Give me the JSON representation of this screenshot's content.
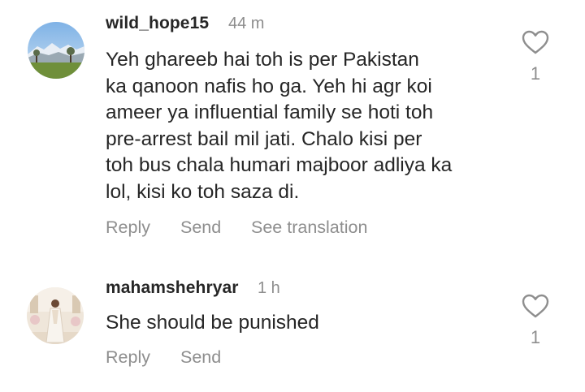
{
  "comments": [
    {
      "username": "wild_hope15",
      "time": "44 m",
      "lines": [
        "Yeh ghareeb hai toh is per Pakistan",
        "ka qanoon nafis ho ga. Yeh hi agr koi",
        "ameer ya influential family se hoti toh",
        "pre-arrest bail mil jati. Chalo kisi per",
        "toh bus chala humari majboor adliya ka",
        "lol, kisi ko toh saza di."
      ],
      "actions": {
        "reply": "Reply",
        "send": "Send",
        "translate": "See translation"
      },
      "likes": "1",
      "avatar": "mountain-landscape-avatar"
    },
    {
      "username": "mahamshehryar",
      "time": "1 h",
      "lines": [
        "She should be punished"
      ],
      "actions": {
        "reply": "Reply",
        "send": "Send"
      },
      "likes": "1",
      "avatar": "person-in-white-dress-avatar"
    }
  ],
  "colors": {
    "text": "#262626",
    "secondary": "#8e8e8e",
    "background": "#ffffff"
  },
  "icons": {
    "like": "heart-outline-icon"
  }
}
